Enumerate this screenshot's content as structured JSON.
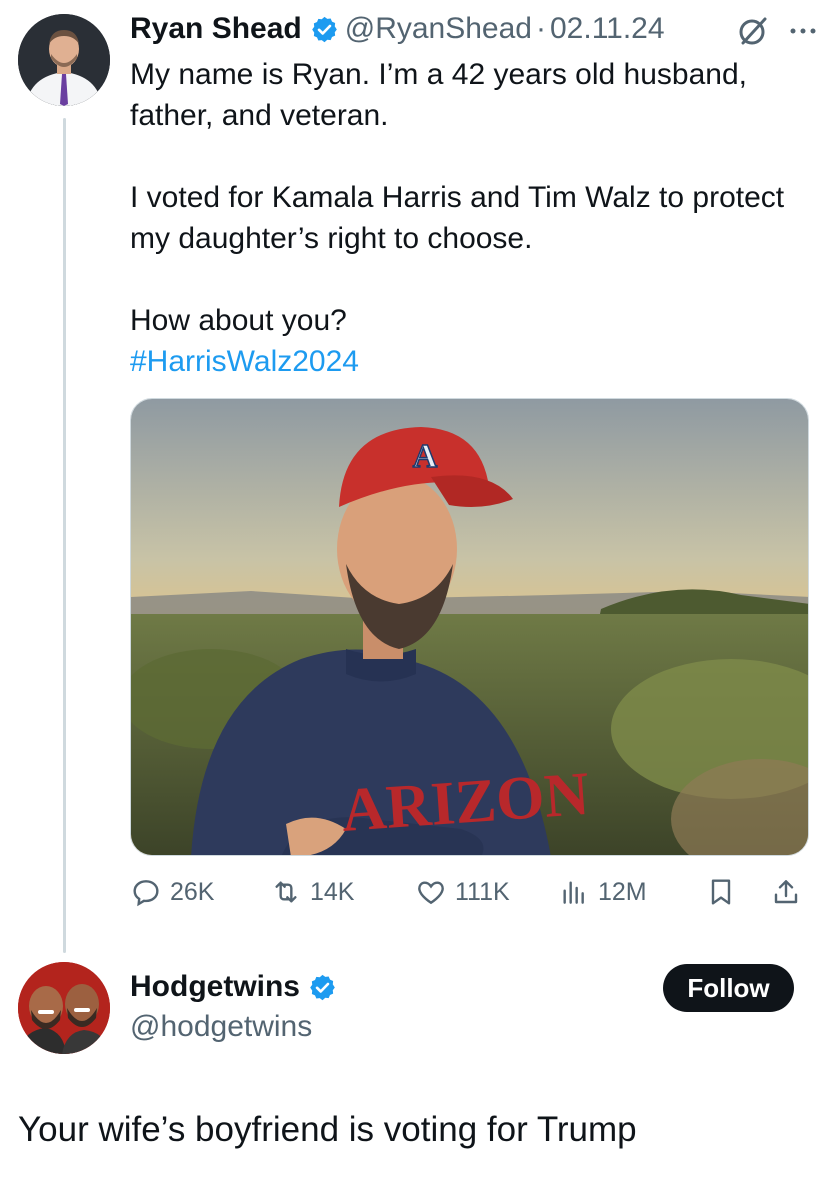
{
  "tweet": {
    "author_name": "Ryan Shead",
    "author_handle": "@RyanShead",
    "separator": "·",
    "date": "02.11.24",
    "paragraphs": [
      "My name is Ryan. I’m a 42 years old husband, father, and veteran.",
      "I voted for Kamala Harris and Tim Walz to protect my daughter’s right to choose.",
      "How about you?"
    ],
    "hashtag": "#HarrisWalz2024",
    "media": {
      "cap_logo": "A",
      "sweatshirt_text": "ARIZON"
    },
    "stats": {
      "replies": "26K",
      "retweets": "14K",
      "likes": "111K",
      "views": "12M"
    }
  },
  "reply": {
    "author_name": "Hodgetwins",
    "author_handle": "@hodgetwins",
    "follow_label": "Follow",
    "text": "Your wife’s boyfriend is voting for Trump"
  },
  "icons": {
    "verified": "verified-badge-icon",
    "grok": "grok-icon",
    "more": "more-icon",
    "reply": "reply-icon",
    "retweet": "retweet-icon",
    "like": "heart-icon",
    "views": "views-icon",
    "bookmark": "bookmark-icon",
    "share": "share-icon"
  },
  "colors": {
    "verified_blue": "#1d9bf0",
    "link_blue": "#1d9bf0",
    "secondary_text": "#536471",
    "primary_text": "#0f1419",
    "follow_button_bg": "#0f1419"
  }
}
